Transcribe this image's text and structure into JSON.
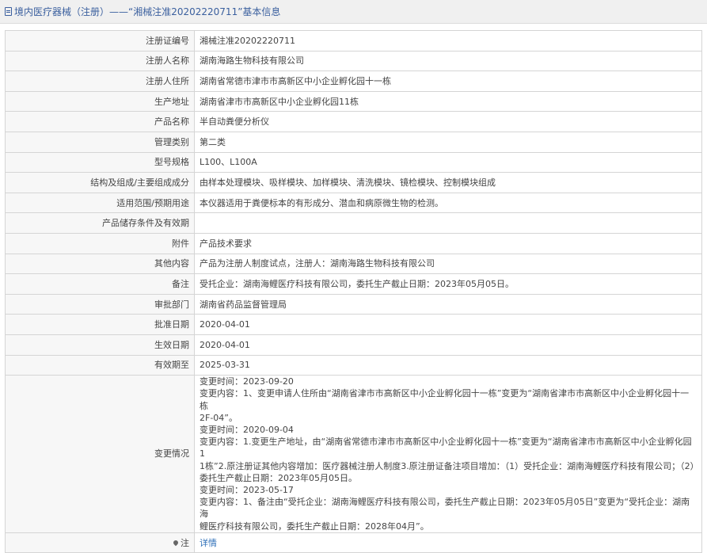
{
  "header": {
    "title": "境内医疗器械（注册）——“湘械注准20202220711”基本信息"
  },
  "rows": [
    {
      "label": "注册证编号",
      "value": "湘械注准20202220711"
    },
    {
      "label": "注册人名称",
      "value": "湖南海路生物科技有限公司"
    },
    {
      "label": "注册人住所",
      "value": "湖南省常德市津市市高新区中小企业孵化园十一栋"
    },
    {
      "label": "生产地址",
      "value": "湖南省津市市高新区中小企业孵化园11栋"
    },
    {
      "label": "产品名称",
      "value": "半自动粪便分析仪"
    },
    {
      "label": "管理类别",
      "value": "第二类"
    },
    {
      "label": "型号规格",
      "value": "L100、L100A"
    },
    {
      "label": "结构及组成/主要组成成分",
      "value": "由样本处理模块、吸样模块、加样模块、清洗模块、镜检模块、控制模块组成"
    },
    {
      "label": "适用范围/预期用途",
      "value": "本仪器适用于粪便标本的有形成分、潜血和病原微生物的检测。"
    },
    {
      "label": "产品储存条件及有效期",
      "value": ""
    },
    {
      "label": "附件",
      "value": "产品技术要求"
    },
    {
      "label": "其他内容",
      "value": "产品为注册人制度试点，注册人：湖南海路生物科技有限公司"
    },
    {
      "label": "备注",
      "value": "受托企业：湖南海鲤医疗科技有限公司，委托生产截止日期：2023年05月05日。"
    },
    {
      "label": "审批部门",
      "value": "湖南省药品监督管理局"
    },
    {
      "label": "批准日期",
      "value": "2020-04-01"
    },
    {
      "label": "生效日期",
      "value": "2020-04-01"
    },
    {
      "label": "有效期至",
      "value": "2025-03-31"
    }
  ],
  "changes": {
    "label": "变更情况",
    "lines": [
      "变更时间：2023-09-20",
      "变更内容：1、变更申请人住所由“湖南省津市市高新区中小企业孵化园十一栋”变更为“湖南省津市市高新区中小企业孵化园十一栋",
      "2F-04”。",
      "变更时间：2020-09-04",
      "变更内容：1.变更生产地址，由“湖南省常德市津市市高新区中小企业孵化园十一栋”变更为“湖南省津市市高新区中小企业孵化园1",
      "1栋”2.原注册证其他内容增加：医疗器械注册人制度3.原注册证备注项目增加：（1）受托企业：湖南海鲤医疗科技有限公司；（2）",
      "委托生产截止日期：2023年05月05日。",
      "变更时间：2023-05-17",
      "变更内容：1、备注由“受托企业：湖南海鲤医疗科技有限公司，委托生产截止日期：2023年05月05日”变更为“受托企业：湖南海",
      "鲤医疗科技有限公司，委托生产截止日期：2028年04月”。"
    ]
  },
  "note": {
    "label": "注",
    "link": "详情",
    "icon": "pin-icon"
  }
}
